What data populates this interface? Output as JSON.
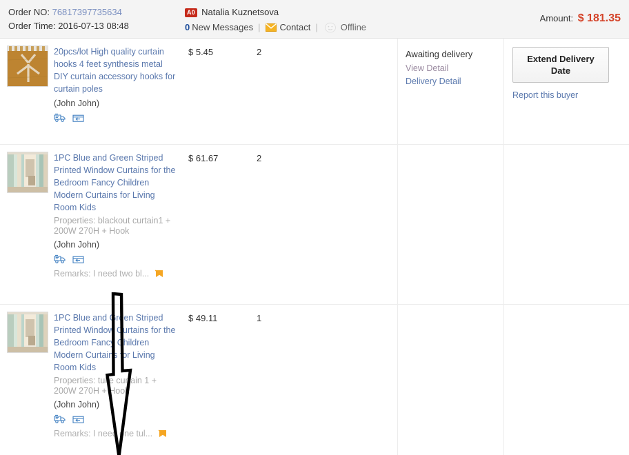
{
  "header": {
    "order_no_label": "Order NO:",
    "order_no_value": "76817397735634",
    "order_time_label": "Order Time:",
    "order_time_value": "2016-07-13 08:48",
    "buyer": {
      "rank_badge": "A0",
      "name": "Natalia Kuznetsova",
      "new_messages_count": "0",
      "new_messages_label": "New Messages",
      "separator": "|",
      "contact_label": "Contact",
      "online_status": "Offline",
      "envelope_icon": "envelope-icon",
      "smiley_icon": "smiley-offline-icon"
    },
    "amount_label": "Amount:",
    "amount_value": "$ 181.35"
  },
  "rows": [
    {
      "title": "20pcs/lot High quality curtain hooks 4 feet synthesis metal DIY curtain accessory hooks for curtain poles",
      "properties": "",
      "seller": "(John John)",
      "price": "$ 5.45",
      "qty": "2",
      "remarks": "",
      "thumb_kind": "hooks",
      "status": {
        "label": "Awaiting delivery",
        "view_detail": "View Detail",
        "delivery_detail": "Delivery Detail"
      },
      "action": {
        "extend_button": "Extend Delivery Date",
        "report_link": "Report this buyer"
      }
    },
    {
      "title": "1PC Blue and Green Striped Printed Window Curtains for the Bedroom Fancy Children Modern Curtains for Living Room Kids",
      "properties": "Properties: blackout curtain1 + 200W 270H + Hook",
      "seller": "(John John)",
      "price": "$ 61.67",
      "qty": "2",
      "remarks": "Remarks: I need two bl...",
      "thumb_kind": "curtain",
      "status": {
        "label": "",
        "view_detail": "",
        "delivery_detail": ""
      },
      "action": {
        "extend_button": "",
        "report_link": ""
      }
    },
    {
      "title": "1PC Blue and Green Striped Printed Window Curtains for the Bedroom Fancy Children Modern Curtains for Living Room Kids",
      "properties": "Properties: tulle curtain 1 + 200W 270H + Hook",
      "seller": "(John John)",
      "price": "$ 49.11",
      "qty": "1",
      "remarks": "Remarks: I need one tul...",
      "thumb_kind": "curtain",
      "status": {
        "label": "",
        "view_detail": "",
        "delivery_detail": ""
      },
      "action": {
        "extend_button": "",
        "report_link": ""
      }
    }
  ],
  "icons": {
    "shipping": "shipping-truck-icon",
    "return": "return-box-icon",
    "remark_flag": "remark-flag-icon"
  },
  "annotation": {
    "arrow": "hand-drawn-down-arrow"
  },
  "colors": {
    "link": "#5a78ad",
    "amount": "#d4442a",
    "badge": "#c52a1a",
    "muted": "#a8a8a8"
  }
}
